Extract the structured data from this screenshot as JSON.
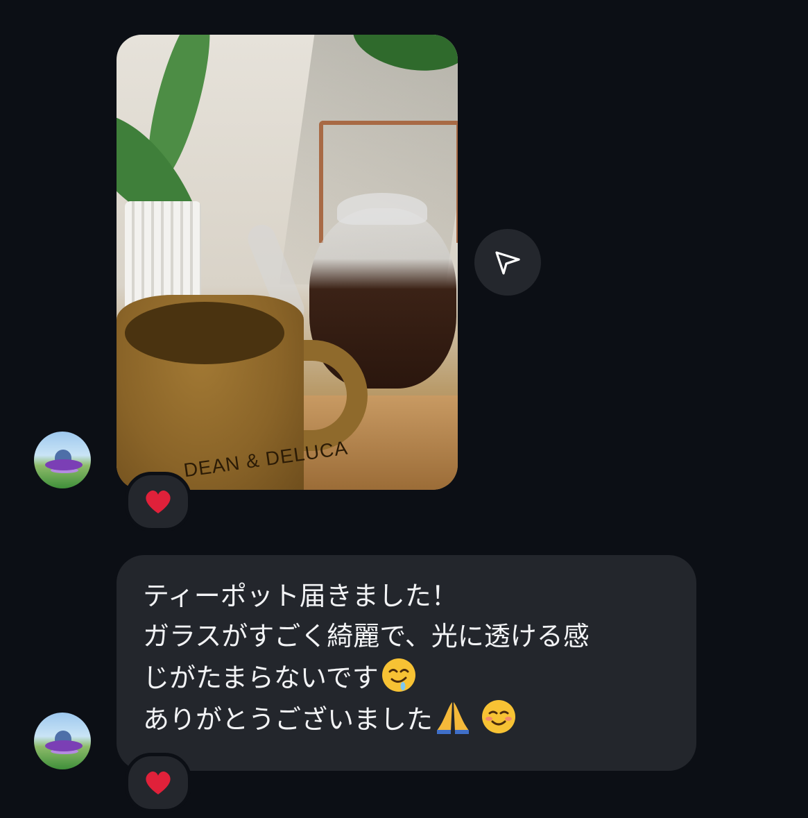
{
  "message_image": {
    "alt": "teapot and mug photo",
    "mug_print": "DEAN & DELUCA"
  },
  "share_button": {
    "icon": "paper-plane-icon"
  },
  "reactions": [
    {
      "emoji": "❤️",
      "icon": "red-heart-icon"
    },
    {
      "emoji": "❤️",
      "icon": "red-heart-icon"
    }
  ],
  "text_message": {
    "lines": [
      "ティーポット届きました！",
      "ガラスがすごく綺麗で、光に透ける感",
      "じがたまらないです",
      "ありがとうございました"
    ],
    "emojis": {
      "drooling": "🤤",
      "folded_hands": "🙏",
      "smiling": "☺️"
    }
  },
  "colors": {
    "background": "#0c0f15",
    "bubble": "#23262c",
    "text": "#f2f3f5",
    "heart": "#e0213a"
  }
}
